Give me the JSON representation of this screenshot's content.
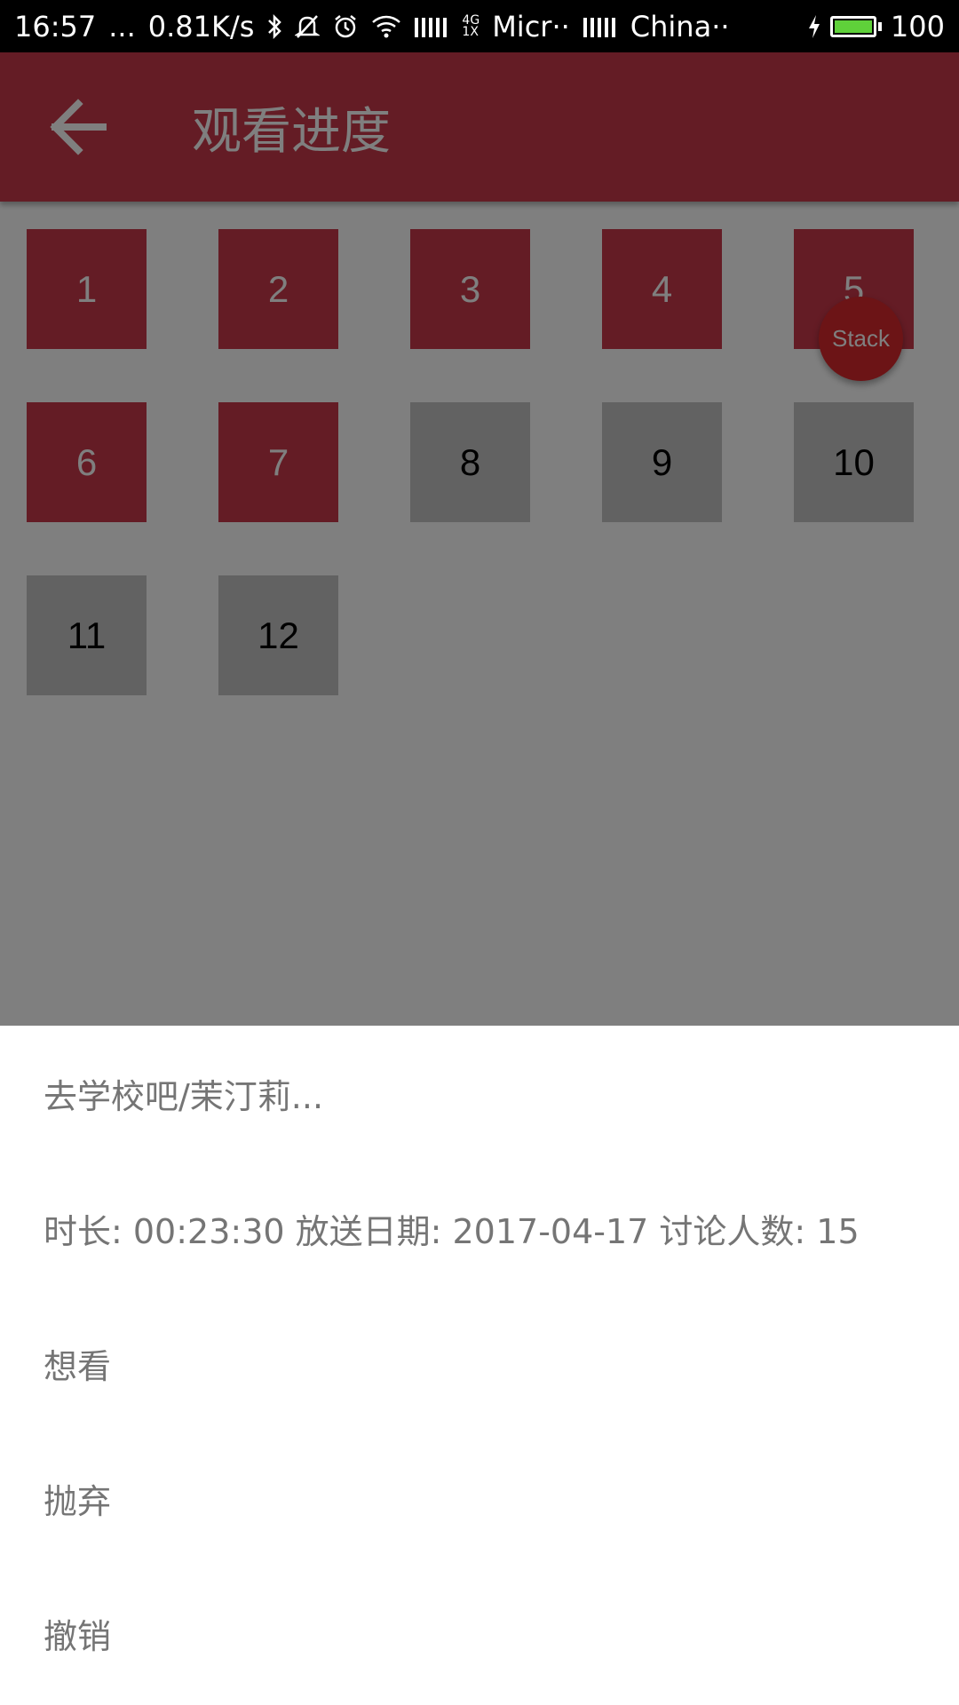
{
  "status_bar": {
    "time": "16:57",
    "dots": "...",
    "speed": "0.81K/s",
    "network_small_top": "4G",
    "network_small_bottom": "1X",
    "carrier1": "Micr··",
    "carrier2": "China··",
    "battery_level": "100"
  },
  "app_bar": {
    "title": "观看进度",
    "color": "#c9384a"
  },
  "episodes": [
    {
      "label": "1",
      "watched": true
    },
    {
      "label": "2",
      "watched": true
    },
    {
      "label": "3",
      "watched": true
    },
    {
      "label": "4",
      "watched": true
    },
    {
      "label": "5",
      "watched": true
    },
    {
      "label": "6",
      "watched": true
    },
    {
      "label": "7",
      "watched": true
    },
    {
      "label": "8",
      "watched": false
    },
    {
      "label": "9",
      "watched": false
    },
    {
      "label": "10",
      "watched": false
    },
    {
      "label": "11",
      "watched": false
    },
    {
      "label": "12",
      "watched": false
    }
  ],
  "fab": {
    "label": "Stack"
  },
  "bottom_sheet": {
    "title": "去学校吧/茉汀莉...",
    "info": "时长: 00:23:30 放送日期: 2017-04-17 讨论人数: 15",
    "actions": [
      {
        "label": "想看"
      },
      {
        "label": "抛弃"
      },
      {
        "label": "撤销"
      }
    ]
  }
}
